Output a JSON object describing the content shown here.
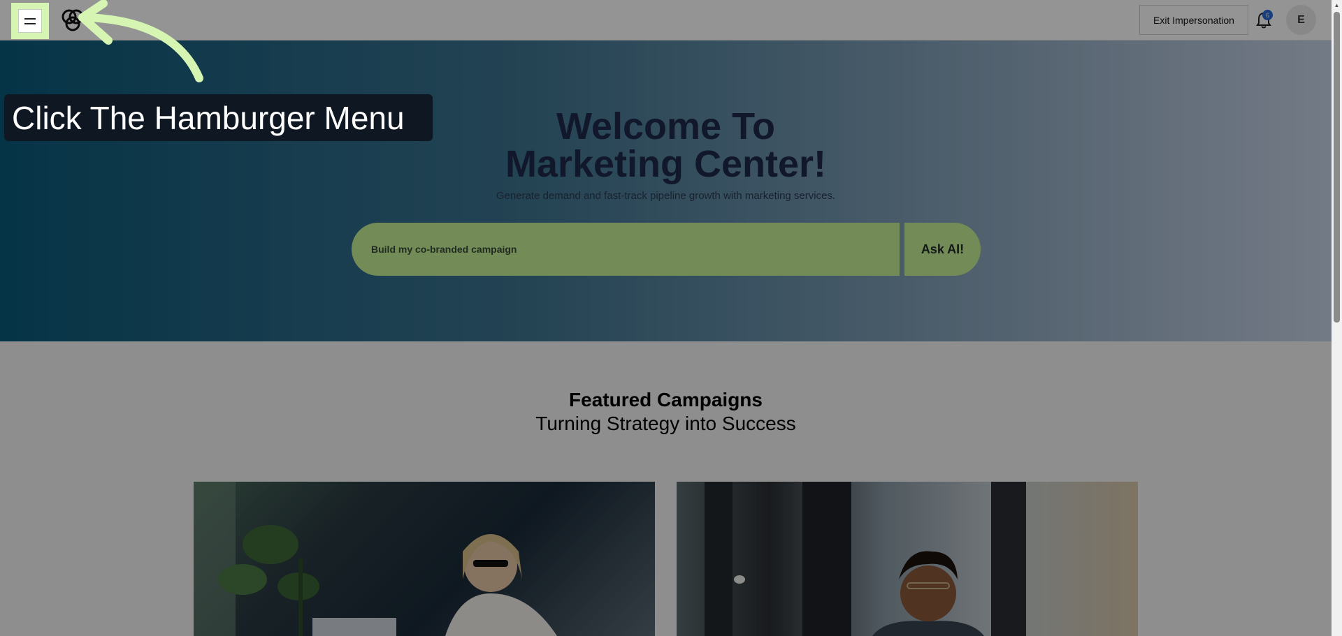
{
  "header": {
    "exit_label": "Exit Impersonation",
    "notification_count": "6",
    "avatar_initial": "E"
  },
  "hero": {
    "title_line1": "Welcome To",
    "title_line2": "Marketing Center!",
    "subtitle": "Generate demand and fast-track pipeline growth with marketing services.",
    "ask_input": "Build my co-branded campaign",
    "ask_button": "Ask AI!"
  },
  "featured": {
    "title": "Featured Campaigns",
    "subtitle": "Turning Strategy into Success"
  },
  "guide": {
    "tooltip": "Click The Hamburger Menu"
  },
  "colors": {
    "accent_green": "#c6f296",
    "highlight": "#d6f5b3",
    "title_navy": "#1f2a4a"
  }
}
